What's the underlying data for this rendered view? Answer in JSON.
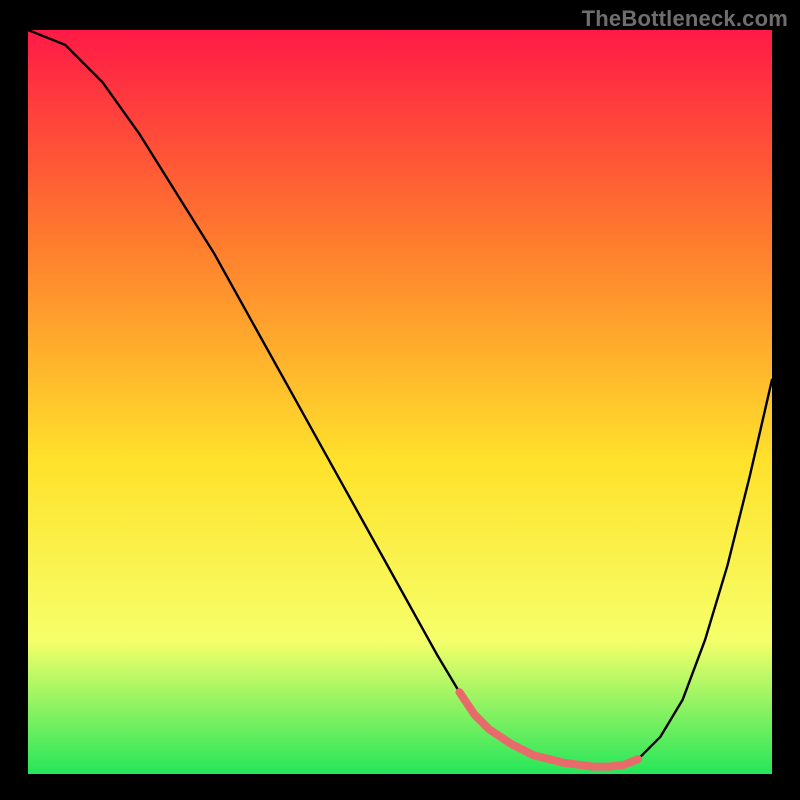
{
  "watermark": "TheBottleneck.com",
  "colors": {
    "page_bg": "#000000",
    "grad_top": "#ff1a46",
    "grad_mid1": "#ff7a2e",
    "grad_mid2": "#ffe22b",
    "grad_mid3": "#f6ff6a",
    "grad_bottom": "#25e65a",
    "curve": "#000000",
    "accent": "#e86a6a"
  },
  "chart_data": {
    "type": "line",
    "title": "",
    "xlabel": "",
    "ylabel": "",
    "xlim": [
      0,
      100
    ],
    "ylim": [
      0,
      100
    ],
    "grid": false,
    "series": [
      {
        "name": "curve",
        "x": [
          0,
          5,
          10,
          15,
          20,
          25,
          30,
          35,
          40,
          45,
          50,
          55,
          58,
          60,
          62,
          65,
          68,
          72,
          76,
          78,
          80,
          82,
          85,
          88,
          91,
          94,
          97,
          100
        ],
        "y": [
          100,
          98,
          93,
          86,
          78,
          70,
          61,
          52,
          43,
          34,
          25,
          16,
          11,
          8,
          6,
          4,
          2.5,
          1.5,
          1,
          1,
          1.2,
          2,
          5,
          10,
          18,
          28,
          40,
          53
        ]
      }
    ],
    "annotations": [
      {
        "name": "accent-segment",
        "type": "line-overlay",
        "color": "#e86a6a",
        "thickness": 8,
        "x": [
          58,
          60,
          62,
          65,
          68,
          72,
          76,
          78,
          80,
          82
        ],
        "y": [
          11,
          8,
          6,
          4,
          2.5,
          1.5,
          1,
          1,
          1.2,
          2
        ]
      }
    ]
  }
}
